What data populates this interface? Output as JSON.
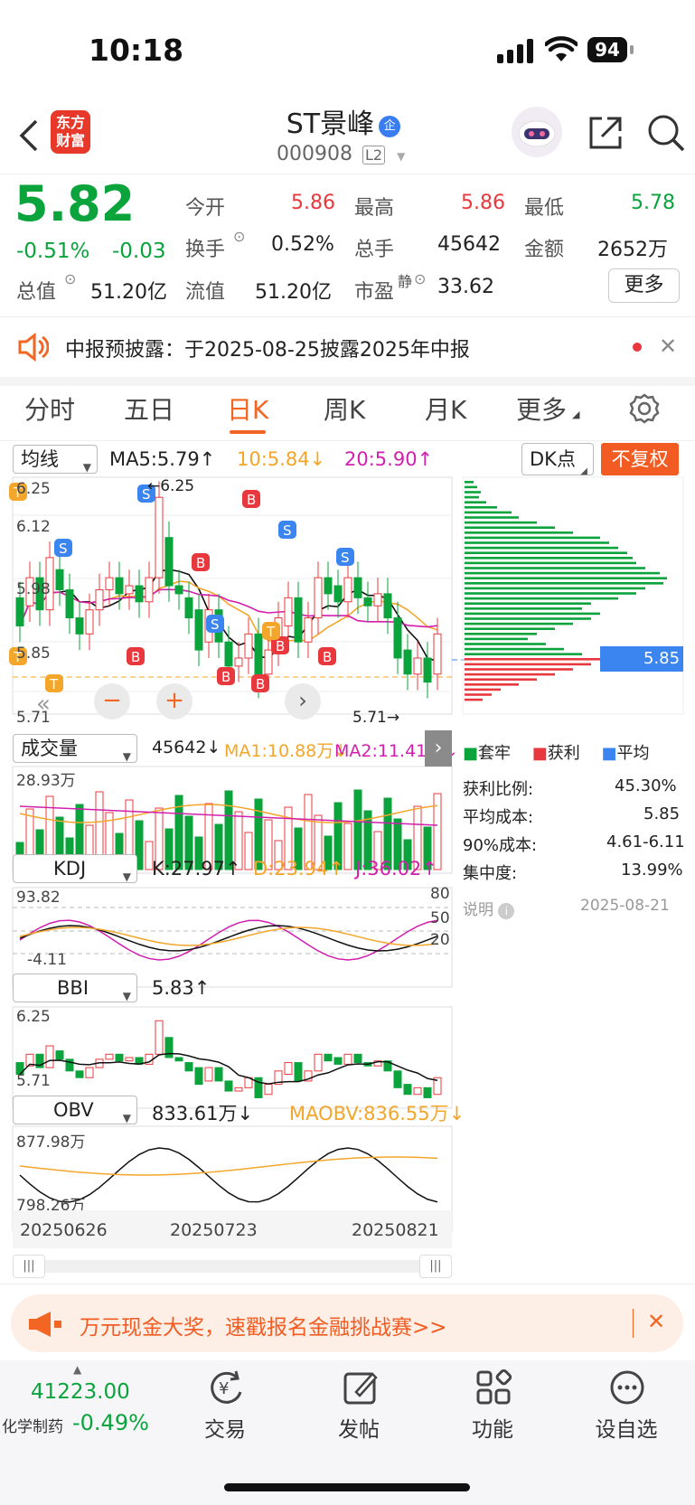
{
  "status": {
    "time": "10:18",
    "battery": "94"
  },
  "header": {
    "title": "ST景峰",
    "code": "000908",
    "level": "L2",
    "logo": "东方\n财富",
    "badge": "企"
  },
  "quote": {
    "price": "5.82",
    "pct": "-0.51%",
    "chg": "-0.03",
    "open_l": "今开",
    "open_v": "5.86",
    "high_l": "最高",
    "high_v": "5.86",
    "low_l": "最低",
    "low_v": "5.78",
    "turn_l": "换手",
    "turn_v": "0.52%",
    "vol_l": "总手",
    "vol_v": "45642",
    "amt_l": "金额",
    "amt_v": "2652万",
    "mcap_l": "总值",
    "mcap_v": "51.20亿",
    "flt_l": "流值",
    "flt_v": "51.20亿",
    "pe_l": "市盈",
    "pe_sup": "静",
    "pe_v": "33.62",
    "more": "更多"
  },
  "notice": {
    "text": "中报预披露：于2025-08-25披露2025年中报"
  },
  "tabs": [
    "分时",
    "五日",
    "日K",
    "周K",
    "月K",
    "更多"
  ],
  "ma_bar": {
    "sel": "均线",
    "ma5": "MA5:5.79↑",
    "ma10": "10:5.84↓",
    "ma20": "20:5.90↑",
    "dk": "DK点",
    "fq": "不复权"
  },
  "chart": {
    "hi": "6.25",
    "mid": "6.12",
    "l3": "5.98",
    "l4": "5.85",
    "lo": "5.71",
    "hi_mark": "←6.25",
    "lo_mark": "5.71→"
  },
  "chip": {
    "price": "5.85",
    "legend": [
      "套牢",
      "获利",
      "平均"
    ],
    "rows": [
      [
        "获利比例:",
        "45.30%"
      ],
      [
        "平均成本:",
        "5.85"
      ],
      [
        "90%成本:",
        "4.61-6.11"
      ],
      [
        "集中度:",
        "13.99%"
      ]
    ],
    "note": "说明",
    "date": "2025-08-21"
  },
  "vol": {
    "sel": "成交量",
    "v": "45642↓",
    "ma1": "MA1:10.88万↓",
    "ma2": "MA2:11.41万↓",
    "max": "28.93万"
  },
  "kdj": {
    "sel": "KDJ",
    "k": "K:27.97↑",
    "d": "D:23.94↑",
    "j": "J:36.02↑",
    "max": "93.82",
    "min": "-4.11",
    "l80": "80",
    "l50": "50",
    "l20": "20"
  },
  "bbi": {
    "sel": "BBI",
    "v": "5.83↑",
    "max": "6.25",
    "min": "5.71"
  },
  "obv": {
    "sel": "OBV",
    "v": "833.61万↓",
    "ma": "MAOBV:836.55万↓",
    "max": "877.98万",
    "min": "798.26万"
  },
  "dates": [
    "20250626",
    "20250723",
    "20250821"
  ],
  "banner": {
    "text": "万元现金大奖，速戳报名金融挑战赛>>"
  },
  "bottom": {
    "index": "41223.00",
    "sector": "化学制药",
    "pct": "-0.49%",
    "items": [
      "交易",
      "发帖",
      "功能",
      "设自选"
    ]
  },
  "colors": {
    "red": "#e8383d",
    "green": "#0aa33c",
    "orange": "#f39c12",
    "accent": "#f26522"
  }
}
